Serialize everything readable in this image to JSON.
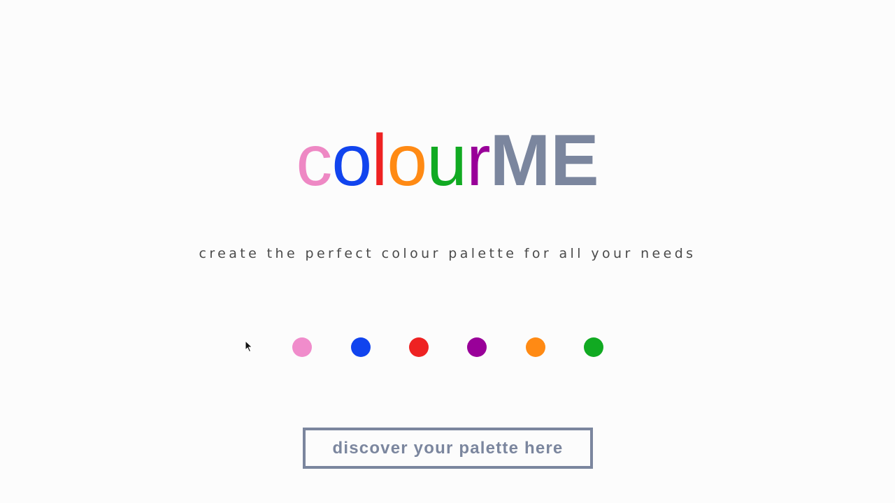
{
  "logo": {
    "letters": [
      {
        "char": "c",
        "color": "#ee88c4"
      },
      {
        "char": "o",
        "color": "#1144ee"
      },
      {
        "char": "l",
        "color": "#ee2222"
      },
      {
        "char": "o",
        "color": "#ff8a14"
      },
      {
        "char": "u",
        "color": "#11aa22"
      },
      {
        "char": "r",
        "color": "#990099"
      }
    ],
    "me": {
      "text": "ME",
      "color": "#7b869e"
    }
  },
  "tagline": "create the perfect colour palette for all your needs",
  "palette": {
    "swatches": [
      {
        "name": "pink",
        "color": "#f08ccb"
      },
      {
        "name": "blue",
        "color": "#1144ee"
      },
      {
        "name": "red",
        "color": "#ee2222"
      },
      {
        "name": "purple",
        "color": "#990099"
      },
      {
        "name": "orange",
        "color": "#ff8a14"
      },
      {
        "name": "green",
        "color": "#11aa22"
      }
    ]
  },
  "cta": {
    "label": "discover your palette here"
  },
  "cursor": {
    "icon": "mouse-pointer-icon"
  }
}
